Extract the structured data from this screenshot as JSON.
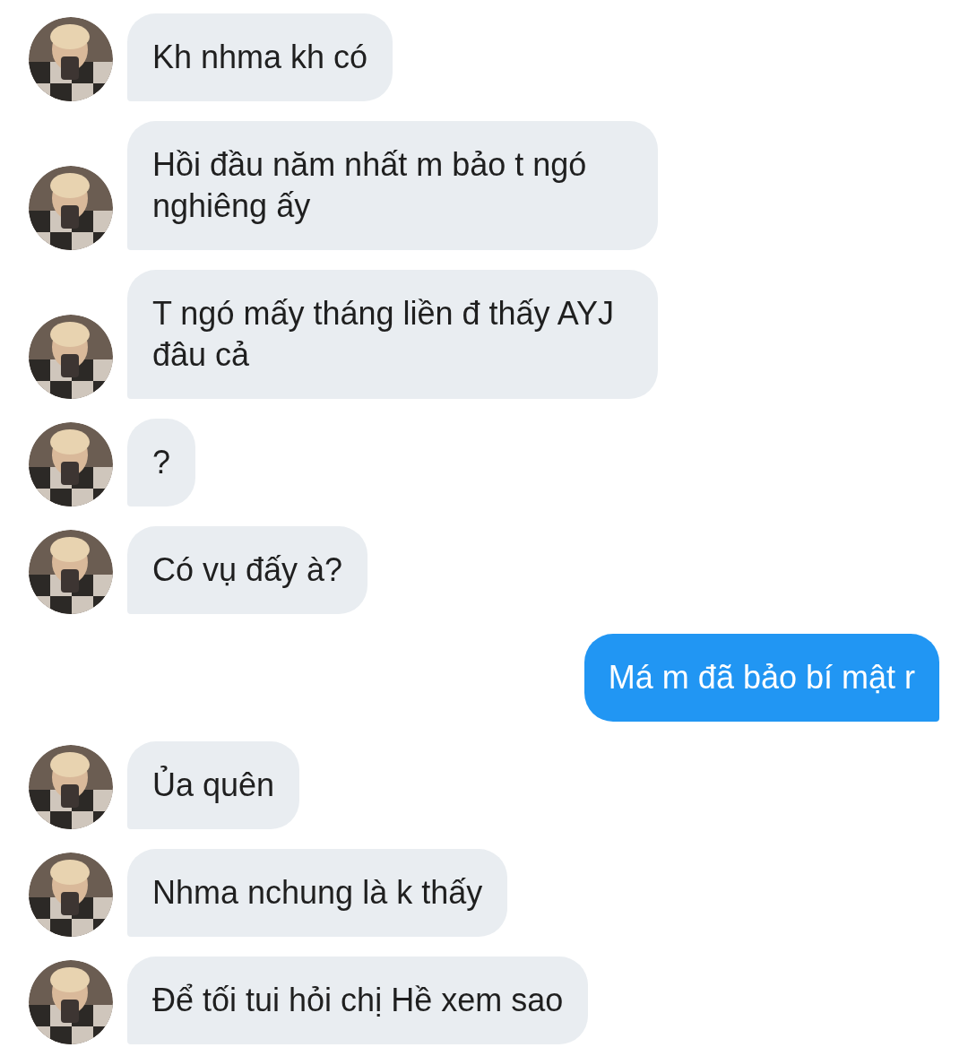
{
  "messages": [
    {
      "kind": "incoming",
      "text": "Kh nhma kh có"
    },
    {
      "kind": "incoming",
      "text": "Hồi đầu năm nhất m bảo t ngó nghiêng ấy"
    },
    {
      "kind": "incoming",
      "text": "T ngó mấy tháng liền đ thấy AYJ đâu cả"
    },
    {
      "kind": "incoming",
      "text": "?"
    },
    {
      "kind": "incoming",
      "text": "Có vụ đấy à?"
    },
    {
      "kind": "outgoing",
      "text": "Má m đã bảo bí mật r"
    },
    {
      "kind": "incoming",
      "text": "Ủa quên"
    },
    {
      "kind": "incoming",
      "text": "Nhma nchung là k thấy"
    },
    {
      "kind": "incoming",
      "text": "Để tối tui hỏi chị Hề xem sao"
    }
  ]
}
